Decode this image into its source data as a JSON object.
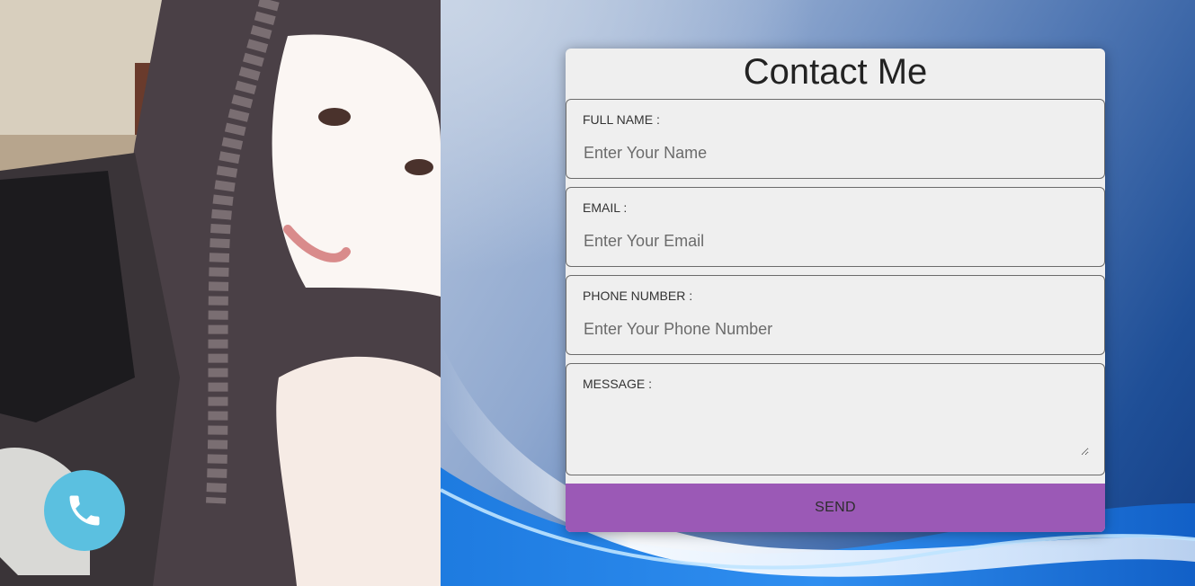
{
  "contact": {
    "title": "Contact Me",
    "fields": {
      "name": {
        "label": "FULL NAME :",
        "placeholder": "Enter Your Name",
        "value": ""
      },
      "email": {
        "label": "EMAIL :",
        "placeholder": "Enter Your Email",
        "value": ""
      },
      "phone": {
        "label": "PHONE NUMBER :",
        "placeholder": "Enter Your Phone Number",
        "value": ""
      },
      "message": {
        "label": "MESSAGE :",
        "value": ""
      }
    },
    "send_label": "SEND"
  },
  "call_button": {
    "icon": "phone-icon",
    "color": "#5bc0e0"
  },
  "colors": {
    "card_background": "#efefef",
    "send_button": "#9b59b6",
    "text": "#222222"
  }
}
